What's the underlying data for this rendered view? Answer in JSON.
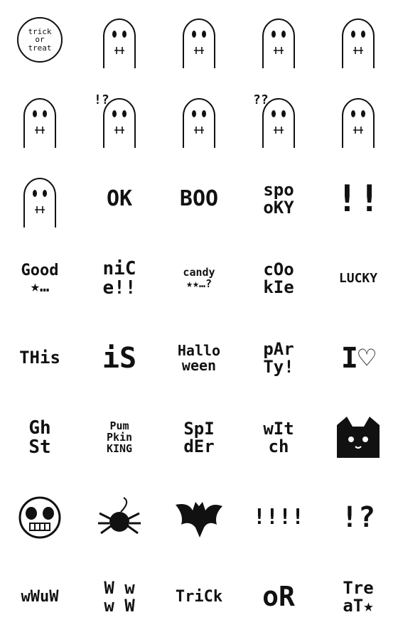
{
  "stickers": [
    {
      "kind": "bubble",
      "text": "trick\nor\ntreat"
    },
    {
      "kind": "ghost",
      "icon": "ghost-icon"
    },
    {
      "kind": "ghost",
      "icon": "ghost-laughing-icon"
    },
    {
      "kind": "ghost",
      "icon": "ghost-grin-icon"
    },
    {
      "kind": "ghost",
      "icon": "ghost-skull-icon"
    },
    {
      "kind": "ghost",
      "icon": "ghost-heart-icon"
    },
    {
      "kind": "ghost",
      "icon": "ghost-surprised-icon",
      "text": "!?"
    },
    {
      "kind": "ghost",
      "icon": "ghost-sunglasses-icon"
    },
    {
      "kind": "ghost",
      "icon": "ghost-question-icon",
      "text": "??"
    },
    {
      "kind": "ghost",
      "icon": "pumpkin-icon"
    },
    {
      "kind": "ghost",
      "icon": "ghost-face-icon"
    },
    {
      "kind": "text",
      "text": "OK",
      "size": 30
    },
    {
      "kind": "text",
      "text": "BOO",
      "size": 30
    },
    {
      "kind": "text",
      "text": "spo\noKY",
      "size": 24
    },
    {
      "kind": "text",
      "text": "!!",
      "size": 52
    },
    {
      "kind": "text",
      "text": "Good\n★…",
      "size": 22
    },
    {
      "kind": "text",
      "text": "niC\ne!!",
      "size": 26
    },
    {
      "kind": "text",
      "text": "candy\n★★…?",
      "size": 15
    },
    {
      "kind": "text",
      "text": "cOo\nkIe",
      "size": 24
    },
    {
      "kind": "text",
      "text": "LUCKY",
      "size": 18
    },
    {
      "kind": "text",
      "text": "THis",
      "size": 24
    },
    {
      "kind": "text",
      "text": "iS",
      "size": 40
    },
    {
      "kind": "text",
      "text": "Hallo\nween",
      "size": 20
    },
    {
      "kind": "text",
      "text": "pAr\nTy!",
      "size": 24
    },
    {
      "kind": "text",
      "text": "I♡",
      "size": 40
    },
    {
      "kind": "text",
      "text": "Gh\nSt",
      "size": 26
    },
    {
      "kind": "text",
      "text": "Pum\nPkin\nKING",
      "size": 15
    },
    {
      "kind": "text",
      "text": "SpI\ndEr",
      "size": 24
    },
    {
      "kind": "text",
      "text": "wIt\nch",
      "size": 24
    },
    {
      "kind": "cat",
      "icon": "black-cat-icon"
    },
    {
      "kind": "skull",
      "icon": "skull-icon"
    },
    {
      "kind": "spider",
      "icon": "spider-icon"
    },
    {
      "kind": "bat",
      "icon": "bat-icon"
    },
    {
      "kind": "text",
      "text": "!!!!",
      "size": 30
    },
    {
      "kind": "text",
      "text": "!?",
      "size": 40
    },
    {
      "kind": "text",
      "text": "wWuW",
      "size": 22
    },
    {
      "kind": "text",
      "text": "W w\nw W",
      "size": 24
    },
    {
      "kind": "text",
      "text": "TriCk",
      "size": 22
    },
    {
      "kind": "text",
      "text": "oR",
      "size": 38
    },
    {
      "kind": "text",
      "text": "Tre\naT★",
      "size": 24
    }
  ]
}
